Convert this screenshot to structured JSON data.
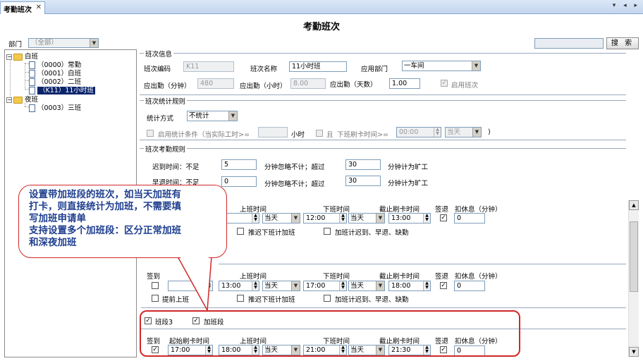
{
  "tab": {
    "label": "考勤班次",
    "close": "✕",
    "nav": "▾ ◂ ▸"
  },
  "page_title": "考勤班次",
  "search": {
    "button": "搜 索",
    "value": ""
  },
  "dept": {
    "label": "部门",
    "value": "（全部）"
  },
  "tree": {
    "groups": [
      {
        "label": "白班",
        "items": [
          "（0000）常勤",
          "（0001）白班",
          "（0002）二班",
          "（K11）11小时班"
        ]
      },
      {
        "label": "夜班",
        "items": [
          "（0003）三班"
        ]
      }
    ]
  },
  "info": {
    "title": "班次信息",
    "code_label": "班次编码",
    "code_value": "K11",
    "name_label": "班次名称",
    "name_value": "11小时班",
    "dept_label": "应用部门",
    "dept_value": "一车间",
    "min_label": "应出勤（分钟）",
    "min_value": "480",
    "hour_label": "应出勤（小时）",
    "hour_value": "8.00",
    "day_label": "应出勤（天数）",
    "day_value": "1.00",
    "enable_label": "启用班次"
  },
  "stat": {
    "title": "班次统计规则",
    "method_label": "统计方式",
    "method_value": "不统计",
    "cond_label": "启用统计条件（当实际工时>=",
    "hours_label": "小时",
    "and_label": "且",
    "offcard_label": "下班刷卡时间>=",
    "time_value": "00:00",
    "day_value": "当天",
    "paren": ")"
  },
  "attend": {
    "title": "班次考勤规则",
    "late_label": "迟到时间：不足",
    "late_value": "5",
    "ignore_label": "分钟忽略不计；超过",
    "late_over": "30",
    "absent_label": "分钟计为旷工",
    "early_label": "早退时间：不足",
    "early_value": "0",
    "early_over": "30"
  },
  "callout": {
    "line1": "设置带加班段的班次，如当天加班有",
    "line2": "打卡，则直接统计为加班，不需要填",
    "line3": "写加班申请单",
    "line4": "支持设置多个加班段：区分正常加班",
    "line5": "和深夜加班"
  },
  "seg1": {
    "h_on": "上班时间",
    "h_off": "下班时间",
    "h_cut": "截止刷卡时间",
    "h_signout": "签退",
    "h_rest": "扣休息（分钟）",
    "on_time": "",
    "on_day": "当天",
    "off_time": "12:00",
    "off_day": "当天",
    "cut_time": "13:00",
    "rest": "0",
    "delay_label": "推迟下班计加班",
    "ot_label": "加班计迟到、早退、缺勤"
  },
  "seg2": {
    "h_signin": "签到",
    "h_start": "间",
    "h_on": "上班时间",
    "h_off": "下班时间",
    "h_cut": "截止刷卡时间",
    "h_signout": "签退",
    "h_rest": "扣休息（分钟）",
    "on_time": "13:00",
    "on_day": "当天",
    "off_time": "17:00",
    "off_day": "当天",
    "cut_time": "18:00",
    "rest": "0",
    "early_label": "提前上班",
    "delay_label": "推迟下班计加班",
    "ot_label": "加班计迟到、早退、缺勤"
  },
  "seg3": {
    "name": "班段3",
    "ot_flag": "加班段",
    "h_signin": "签到",
    "h_start": "起始刷卡时间",
    "h_on": "上班时间",
    "h_off": "下班时间",
    "h_cut": "截止刷卡时间",
    "h_signout": "签退",
    "h_rest": "扣休息（分钟）",
    "start_time": "17:00",
    "on_time": "18:00",
    "on_day": "当天",
    "off_time": "21:00",
    "off_day": "当天",
    "cut_time": "21:30",
    "rest": "0"
  },
  "colors": {
    "accent": "#d02828",
    "callout_text": "#1f3f8f",
    "selection": "#0a246a"
  }
}
